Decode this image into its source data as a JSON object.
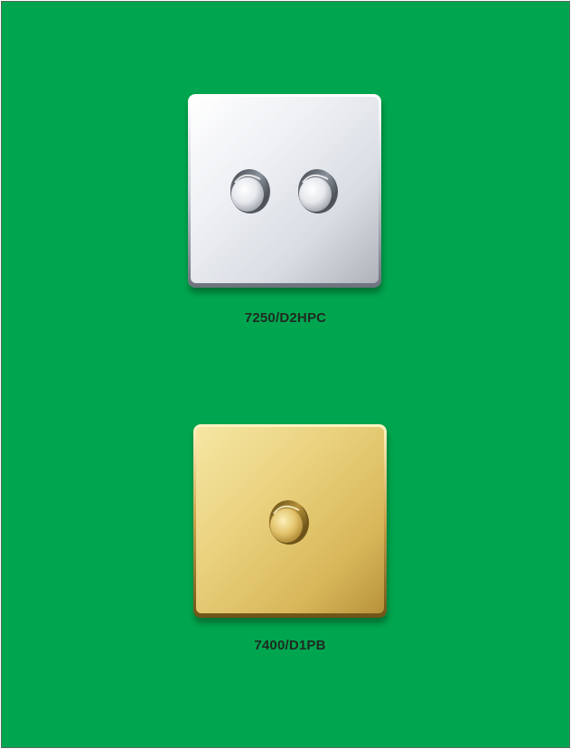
{
  "background_color": "#00a64f",
  "products": [
    {
      "code": "7250/D2HPC",
      "finish": "chrome",
      "knobs": 2
    },
    {
      "code": "7400/D1PB",
      "finish": "brass",
      "knobs": 1
    }
  ]
}
